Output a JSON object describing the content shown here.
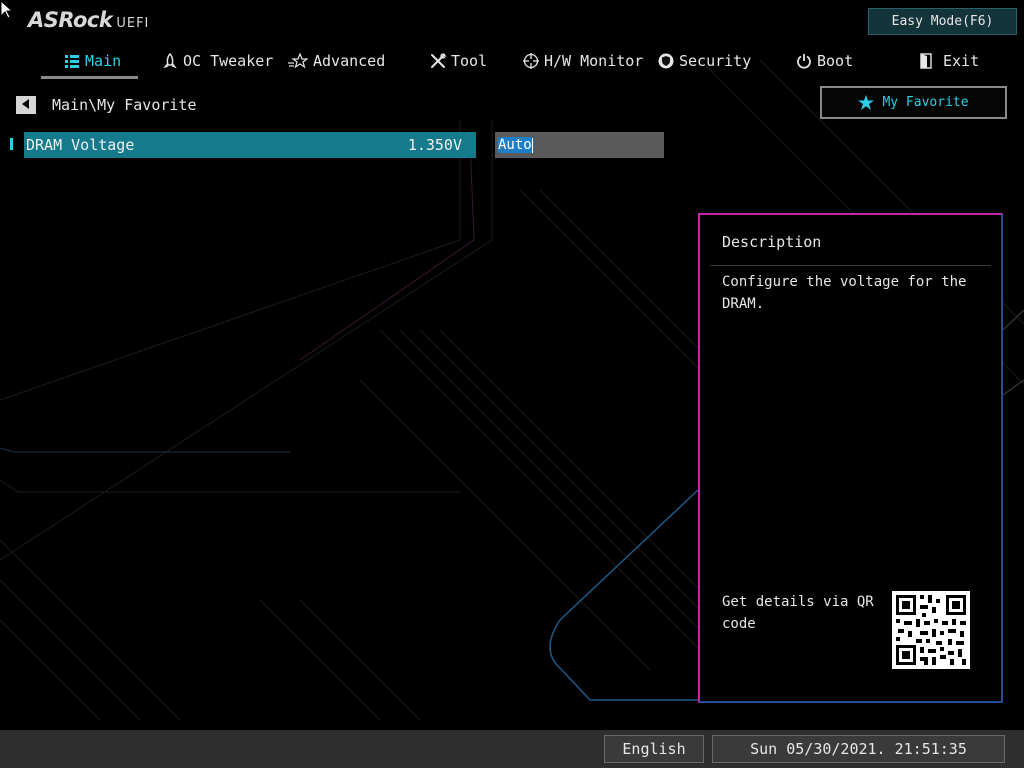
{
  "logo": {
    "brand": "ASRock",
    "suffix": "UEFI"
  },
  "header": {
    "easy_mode_label": "Easy Mode(F6)"
  },
  "tabs": [
    {
      "label": "Main",
      "icon": "list-icon",
      "active": true
    },
    {
      "label": "OC Tweaker",
      "icon": "rocket-icon"
    },
    {
      "label": "Advanced",
      "icon": "star-outline-icon"
    },
    {
      "label": "Tool",
      "icon": "tools-icon"
    },
    {
      "label": "H/W Monitor",
      "icon": "crosshair-icon"
    },
    {
      "label": "Security",
      "icon": "shield-icon"
    },
    {
      "label": "Boot",
      "icon": "power-icon"
    },
    {
      "label": "Exit",
      "icon": "exit-door-icon"
    }
  ],
  "breadcrumb": {
    "path": "Main\\My Favorite"
  },
  "favorite_button": {
    "label": "My Favorite",
    "icon": "star-icon"
  },
  "settings": [
    {
      "label": "DRAM Voltage",
      "value": "1.350V"
    }
  ],
  "edit_field": {
    "value": "Auto"
  },
  "description": {
    "title": "Description",
    "text": "Configure the voltage for the DRAM.",
    "qr_text": "Get details via QR code"
  },
  "footer": {
    "language": "English",
    "datetime": "Sun 05/30/2021. 21:51:35"
  },
  "colors": {
    "accent": "#2ad0e8",
    "selected_row": "#147a8c",
    "panel_border_magenta": "#c02aa8",
    "panel_border_blue": "#2a4a9a"
  }
}
